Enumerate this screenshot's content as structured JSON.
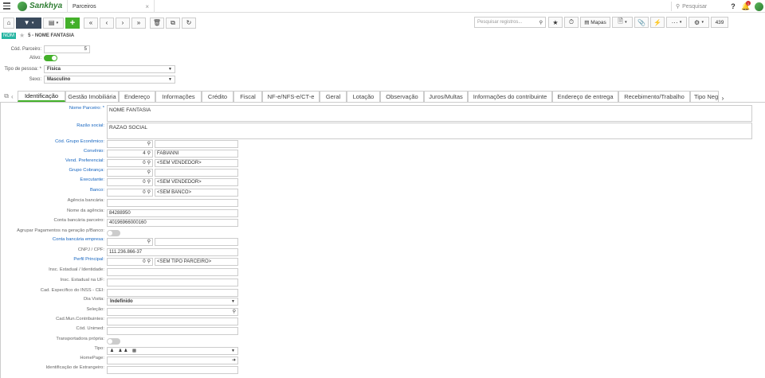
{
  "topbar": {
    "brand": "Sankhya",
    "tab_title": "Parceiros",
    "tab_close": "×",
    "search_placeholder": "Pesquisar",
    "notif_count": "1"
  },
  "toolbar": {
    "search_placeholder": "Pesquisar registros...",
    "mapas_label": "Mapas",
    "counter": "439"
  },
  "breadcrumb": {
    "badge": "NOM",
    "title": "5 - NOME FANTASIA"
  },
  "header": {
    "cod_label": "Cód. Parceiro:",
    "cod_value": "5",
    "ativo_label": "Ativo:",
    "tipo_label": "Tipo de pessoa: *",
    "tipo_value": "Física",
    "sexo_label": "Sexo:",
    "sexo_value": "Masculino"
  },
  "tabs": [
    "Identificação",
    "Gestão Imobiliária",
    "Endereço",
    "Informações",
    "Crédito",
    "Fiscal",
    "NF-e/NFS-e/CT-e",
    "Geral",
    "Lotação",
    "Observação",
    "Juros/Multas",
    "Informações do contribuinte",
    "Endereço de entrega",
    "Recebimento/Trabalho",
    "Tipo Neg"
  ],
  "form": {
    "nome_parceiro": {
      "label": "Nome Parceiro: *",
      "value": "NOME FANTASIA"
    },
    "razao_social": {
      "label": "Razão social:",
      "value": "RAZAO SOCIAL"
    },
    "grupo_economico": {
      "label": "Cód. Grupo Econômico:"
    },
    "convenio": {
      "label": "Convênio:",
      "code": "4",
      "desc": "FABIANNI"
    },
    "vend_preferencial": {
      "label": "Vend. Preferencial:",
      "code": "0",
      "desc": "<SEM VENDEDOR>"
    },
    "grupo_cobranca": {
      "label": "Grupo Cobrança:"
    },
    "executante": {
      "label": "Executante:",
      "code": "0",
      "desc": "<SEM VENDEDOR>"
    },
    "banco": {
      "label": "Banco:",
      "code": "0",
      "desc": "<SEM BANCO>"
    },
    "agencia_bancaria": {
      "label": "Agência bancária:"
    },
    "nome_agencia": {
      "label": "Nome da agência:",
      "value": "84288950"
    },
    "conta_bancaria": {
      "label": "Conta bancária parceiro:",
      "value": "40196966000160"
    },
    "agrupar_pagamentos": {
      "label": "Agrupar Pagamentos na geração p/Banco:"
    },
    "conta_empresa": {
      "label": "Conta bancária empresa:"
    },
    "cnpj": {
      "label": "CNPJ / CPF:",
      "value": "111.236.866-37"
    },
    "perfil_principal": {
      "label": "Perfil Principal:",
      "code": "0",
      "desc": "<SEM TIPO PARCEIRO>"
    },
    "insc_estadual": {
      "label": "Insc. Estadual / Identidade:"
    },
    "insc_estadual_uf": {
      "label": "Insc. Estadual na UF:"
    },
    "cad_inss": {
      "label": "Cad. Específico do INSS - CEI:"
    },
    "dia_visita": {
      "label": "Dia Visita:",
      "value": "Indefinido"
    },
    "selecao": {
      "label": "Seleção:"
    },
    "cad_mun": {
      "label": "Cad.Mun.Contribuintes:"
    },
    "cod_unimed": {
      "label": "Cód. Unimed:"
    },
    "transportadora": {
      "label": "Transportadora própria:"
    },
    "tipo": {
      "label": "Tipo:"
    },
    "homepage": {
      "label": "HomePage:"
    },
    "estrangeiro": {
      "label": "Identificação de Estrangeiro:"
    }
  },
  "colors": {
    "accent": "#43b02a",
    "link": "#1565c0",
    "toolbar_dark": "#3a4a5c",
    "badge": "#26b5a2"
  }
}
